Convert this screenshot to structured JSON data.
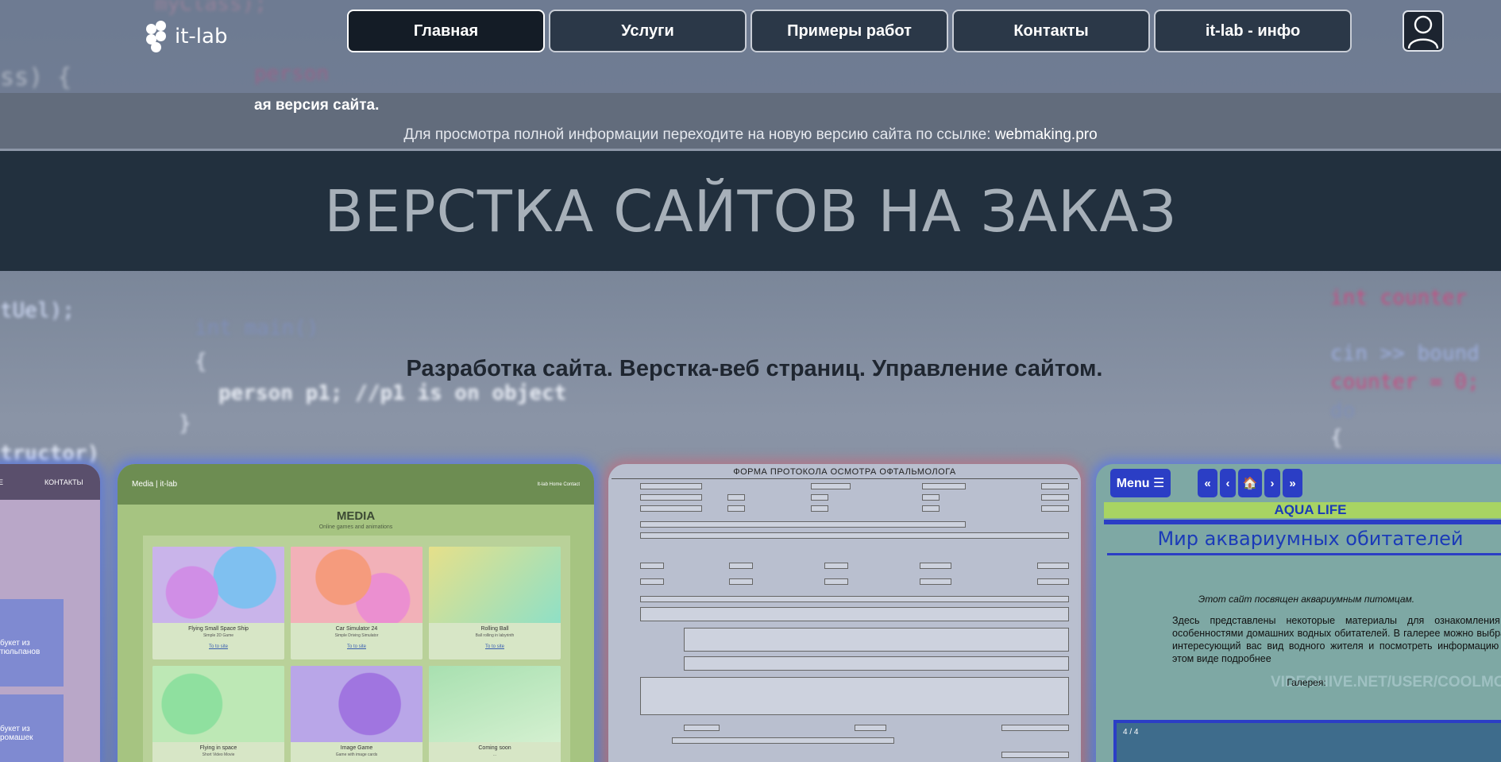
{
  "header": {
    "logo_text": "it-lab",
    "nav": [
      {
        "label": "Главная",
        "active": true
      },
      {
        "label": "Услуги",
        "active": false
      },
      {
        "label": "Примеры работ",
        "active": false
      },
      {
        "label": "Контакты",
        "active": false
      },
      {
        "label": "it-lab - инфо",
        "active": false
      }
    ],
    "user_icon": "user-icon"
  },
  "notice": {
    "marquee": "ая версия сайта.",
    "text": "Для просмотра полной информации переходите на новую версию сайта по ссылке: ",
    "link": "webmaking.pro"
  },
  "hero": {
    "title": "ВЕРСТКА САЙТОВ НА ЗАКАЗ",
    "subtitle": "Разработка сайта. Верстка-веб страниц. Управление сайтом."
  },
  "background_code": [
    "myClass);",
    "ss) {",
    "int main()",
    "{",
    "person p1; //p1 is on object",
    "}",
    "tructor)",
    "tUel);",
    "int counter",
    "cin >> bound",
    "counter = 0;",
    "do",
    "{",
    "person"
  ],
  "cards": {
    "card0": {
      "nav_item": "КОНТАКТЫ",
      "nav_item_left": "Е",
      "tile1": "букет из тюльпанов",
      "tile2": "букет из ромашек"
    },
    "media": {
      "brand": "Media | it-lab",
      "nav": "It-lab  Home  Contact",
      "title": "MEDIA",
      "subtitle": "Online games and animations",
      "tiles": [
        {
          "title": "Flying Small Space Ship",
          "sub": "Simple 2D Game",
          "link": "To to site",
          "color": "#c9b4ea"
        },
        {
          "title": "Car Simulator 24",
          "sub": "Simple Driving Simulator",
          "link": "To to site",
          "color": "#f2b1b8"
        },
        {
          "title": "Rolling Ball",
          "sub": "Ball rolling in labyrinth",
          "link": "To to site",
          "color": "#b9e0a9"
        },
        {
          "title": "Flying in space",
          "sub": "Short Video Movie",
          "link": "",
          "color": "#bde8b5"
        },
        {
          "title": "Image Game",
          "sub": "Game with image cards",
          "link": "",
          "color": "#b9a6e8"
        },
        {
          "title": "Coming soon",
          "sub": "...",
          "link": "",
          "color": "#c5e7c5"
        }
      ]
    },
    "form": {
      "title": "ФОРМА ПРОТОКОЛА ОСМОТРА ОФТАЛЬМОЛОГА"
    },
    "aqua": {
      "menu": "Menu ☰",
      "pager": [
        "«",
        "‹",
        "🏠",
        "›",
        "»"
      ],
      "band": "AQUA LIFE",
      "title": "Мир аквариумных обитателей",
      "p1": "Этот сайт посвящен аквариумным питомцам.",
      "p2": "Здесь представлены некоторые материалы для ознакомления с особенностями домашних водных обитателей. В галерее можно выбрать интересующий вас вид водного жителя и посмотреть информацию об этом виде подробнее",
      "watermark": "VIDEOHIVE.NET/USER/COOLMO",
      "gallery": "Галерея:",
      "slide": "4 / 4"
    }
  }
}
